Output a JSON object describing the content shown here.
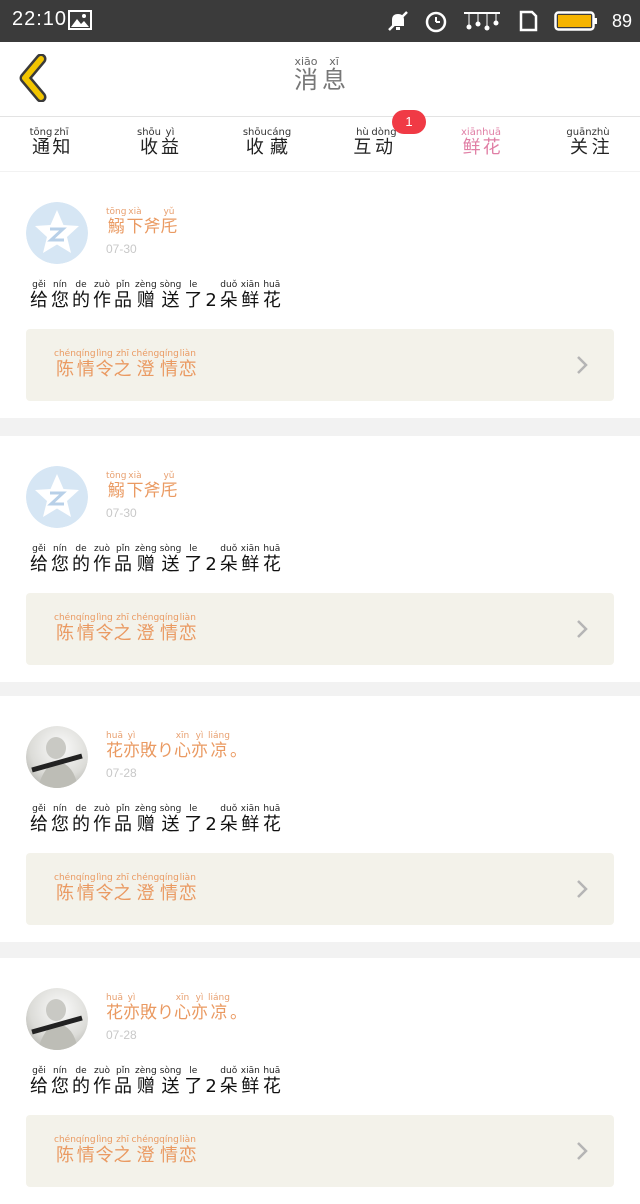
{
  "status_bar": {
    "time": "22:10",
    "battery": "89"
  },
  "header": {
    "title": [
      {
        "py": "xiāo",
        "hz": "消"
      },
      {
        "py": "xī",
        "hz": "息"
      }
    ]
  },
  "tabs": [
    {
      "label": [
        {
          "py": "tōng",
          "hz": "通"
        },
        {
          "py": "zhī",
          "hz": "知"
        }
      ]
    },
    {
      "label": [
        {
          "py": "shōu",
          "hz": "收"
        },
        {
          "py": "yì",
          "hz": "益"
        }
      ]
    },
    {
      "label": [
        {
          "py": "shōu",
          "hz": "收"
        },
        {
          "py": "cáng",
          "hz": "藏"
        }
      ]
    },
    {
      "label": [
        {
          "py": "hù",
          "hz": "互"
        },
        {
          "py": "dòng",
          "hz": "动"
        }
      ],
      "badge": "1"
    },
    {
      "label": [
        {
          "py": "xiān",
          "hz": "鲜"
        },
        {
          "py": "huā",
          "hz": "花"
        }
      ],
      "active": true
    },
    {
      "label": [
        {
          "py": "guān",
          "hz": "关"
        },
        {
          "py": "zhù",
          "hz": "注"
        }
      ]
    }
  ],
  "messages": [
    {
      "sender": [
        {
          "py": "tōng",
          "hz": "鰯"
        },
        {
          "py": "xià",
          "hz": "下"
        },
        {
          "py": "",
          "hz": "斧"
        },
        {
          "py": "yǔ",
          "hz": "厇"
        }
      ],
      "time": "07-30",
      "avatar": "qzone-default-icon",
      "text": [
        {
          "py": "gěi",
          "hz": "给"
        },
        {
          "py": "nín",
          "hz": "您"
        },
        {
          "py": "de",
          "hz": "的"
        },
        {
          "py": "zuò",
          "hz": "作"
        },
        {
          "py": "pǐn",
          "hz": "品"
        },
        {
          "py": "zèng",
          "hz": "赠"
        },
        {
          "py": "sòng",
          "hz": "送"
        },
        {
          "py": "le",
          "hz": "了"
        },
        {
          "py": "",
          "hz": "2"
        },
        {
          "py": "duǒ",
          "hz": "朵"
        },
        {
          "py": "xiān",
          "hz": "鲜"
        },
        {
          "py": "huā",
          "hz": "花"
        }
      ],
      "work": [
        {
          "py": "chén",
          "hz": "陈"
        },
        {
          "py": "qíng",
          "hz": "情"
        },
        {
          "py": "lìng",
          "hz": "令"
        },
        {
          "py": "zhī",
          "hz": "之"
        },
        {
          "py": "chéng",
          "hz": "澄"
        },
        {
          "py": "qíng",
          "hz": "情"
        },
        {
          "py": "liàn",
          "hz": "恋"
        }
      ]
    },
    {
      "sender": [
        {
          "py": "tōng",
          "hz": "鰯"
        },
        {
          "py": "xià",
          "hz": "下"
        },
        {
          "py": "",
          "hz": "斧"
        },
        {
          "py": "yǔ",
          "hz": "厇"
        }
      ],
      "time": "07-30",
      "avatar": "qzone-default-icon",
      "text": [
        {
          "py": "gěi",
          "hz": "给"
        },
        {
          "py": "nín",
          "hz": "您"
        },
        {
          "py": "de",
          "hz": "的"
        },
        {
          "py": "zuò",
          "hz": "作"
        },
        {
          "py": "pǐn",
          "hz": "品"
        },
        {
          "py": "zèng",
          "hz": "赠"
        },
        {
          "py": "sòng",
          "hz": "送"
        },
        {
          "py": "le",
          "hz": "了"
        },
        {
          "py": "",
          "hz": "2"
        },
        {
          "py": "duǒ",
          "hz": "朵"
        },
        {
          "py": "xiān",
          "hz": "鲜"
        },
        {
          "py": "huā",
          "hz": "花"
        }
      ],
      "work": [
        {
          "py": "chén",
          "hz": "陈"
        },
        {
          "py": "qíng",
          "hz": "情"
        },
        {
          "py": "lìng",
          "hz": "令"
        },
        {
          "py": "zhī",
          "hz": "之"
        },
        {
          "py": "chéng",
          "hz": "澄"
        },
        {
          "py": "qíng",
          "hz": "情"
        },
        {
          "py": "liàn",
          "hz": "恋"
        }
      ]
    },
    {
      "sender": [
        {
          "py": "huā",
          "hz": "花"
        },
        {
          "py": "yì",
          "hz": "亦"
        },
        {
          "py": "",
          "hz": "敗"
        },
        {
          "py": "",
          "hz": "り"
        },
        {
          "py": "xīn",
          "hz": "心"
        },
        {
          "py": "yì",
          "hz": "亦"
        },
        {
          "py": "liáng",
          "hz": "凉"
        },
        {
          "py": "",
          "hz": "。"
        }
      ],
      "time": "07-28",
      "avatar": "user-photo",
      "text": [
        {
          "py": "gěi",
          "hz": "给"
        },
        {
          "py": "nín",
          "hz": "您"
        },
        {
          "py": "de",
          "hz": "的"
        },
        {
          "py": "zuò",
          "hz": "作"
        },
        {
          "py": "pǐn",
          "hz": "品"
        },
        {
          "py": "zèng",
          "hz": "赠"
        },
        {
          "py": "sòng",
          "hz": "送"
        },
        {
          "py": "le",
          "hz": "了"
        },
        {
          "py": "",
          "hz": "2"
        },
        {
          "py": "duǒ",
          "hz": "朵"
        },
        {
          "py": "xiān",
          "hz": "鲜"
        },
        {
          "py": "huā",
          "hz": "花"
        }
      ],
      "work": [
        {
          "py": "chén",
          "hz": "陈"
        },
        {
          "py": "qíng",
          "hz": "情"
        },
        {
          "py": "lìng",
          "hz": "令"
        },
        {
          "py": "zhī",
          "hz": "之"
        },
        {
          "py": "chéng",
          "hz": "澄"
        },
        {
          "py": "qíng",
          "hz": "情"
        },
        {
          "py": "liàn",
          "hz": "恋"
        }
      ]
    },
    {
      "sender": [
        {
          "py": "huā",
          "hz": "花"
        },
        {
          "py": "yì",
          "hz": "亦"
        },
        {
          "py": "",
          "hz": "敗"
        },
        {
          "py": "",
          "hz": "り"
        },
        {
          "py": "xīn",
          "hz": "心"
        },
        {
          "py": "yì",
          "hz": "亦"
        },
        {
          "py": "liáng",
          "hz": "凉"
        },
        {
          "py": "",
          "hz": "。"
        }
      ],
      "time": "07-28",
      "avatar": "user-photo",
      "text": [
        {
          "py": "gěi",
          "hz": "给"
        },
        {
          "py": "nín",
          "hz": "您"
        },
        {
          "py": "de",
          "hz": "的"
        },
        {
          "py": "zuò",
          "hz": "作"
        },
        {
          "py": "pǐn",
          "hz": "品"
        },
        {
          "py": "zèng",
          "hz": "赠"
        },
        {
          "py": "sòng",
          "hz": "送"
        },
        {
          "py": "le",
          "hz": "了"
        },
        {
          "py": "",
          "hz": "2"
        },
        {
          "py": "duǒ",
          "hz": "朵"
        },
        {
          "py": "xiān",
          "hz": "鲜"
        },
        {
          "py": "huā",
          "hz": "花"
        }
      ],
      "work": [
        {
          "py": "chén",
          "hz": "陈"
        },
        {
          "py": "qíng",
          "hz": "情"
        },
        {
          "py": "lìng",
          "hz": "令"
        },
        {
          "py": "zhī",
          "hz": "之"
        },
        {
          "py": "chéng",
          "hz": "澄"
        },
        {
          "py": "qíng",
          "hz": "情"
        },
        {
          "py": "liàn",
          "hz": "恋"
        }
      ]
    }
  ],
  "colors": {
    "accent": "#e07fa5",
    "badge": "#f03a45",
    "name": "#ea9a62",
    "link_bg": "#f3f2ea",
    "back": "#f2c500"
  }
}
